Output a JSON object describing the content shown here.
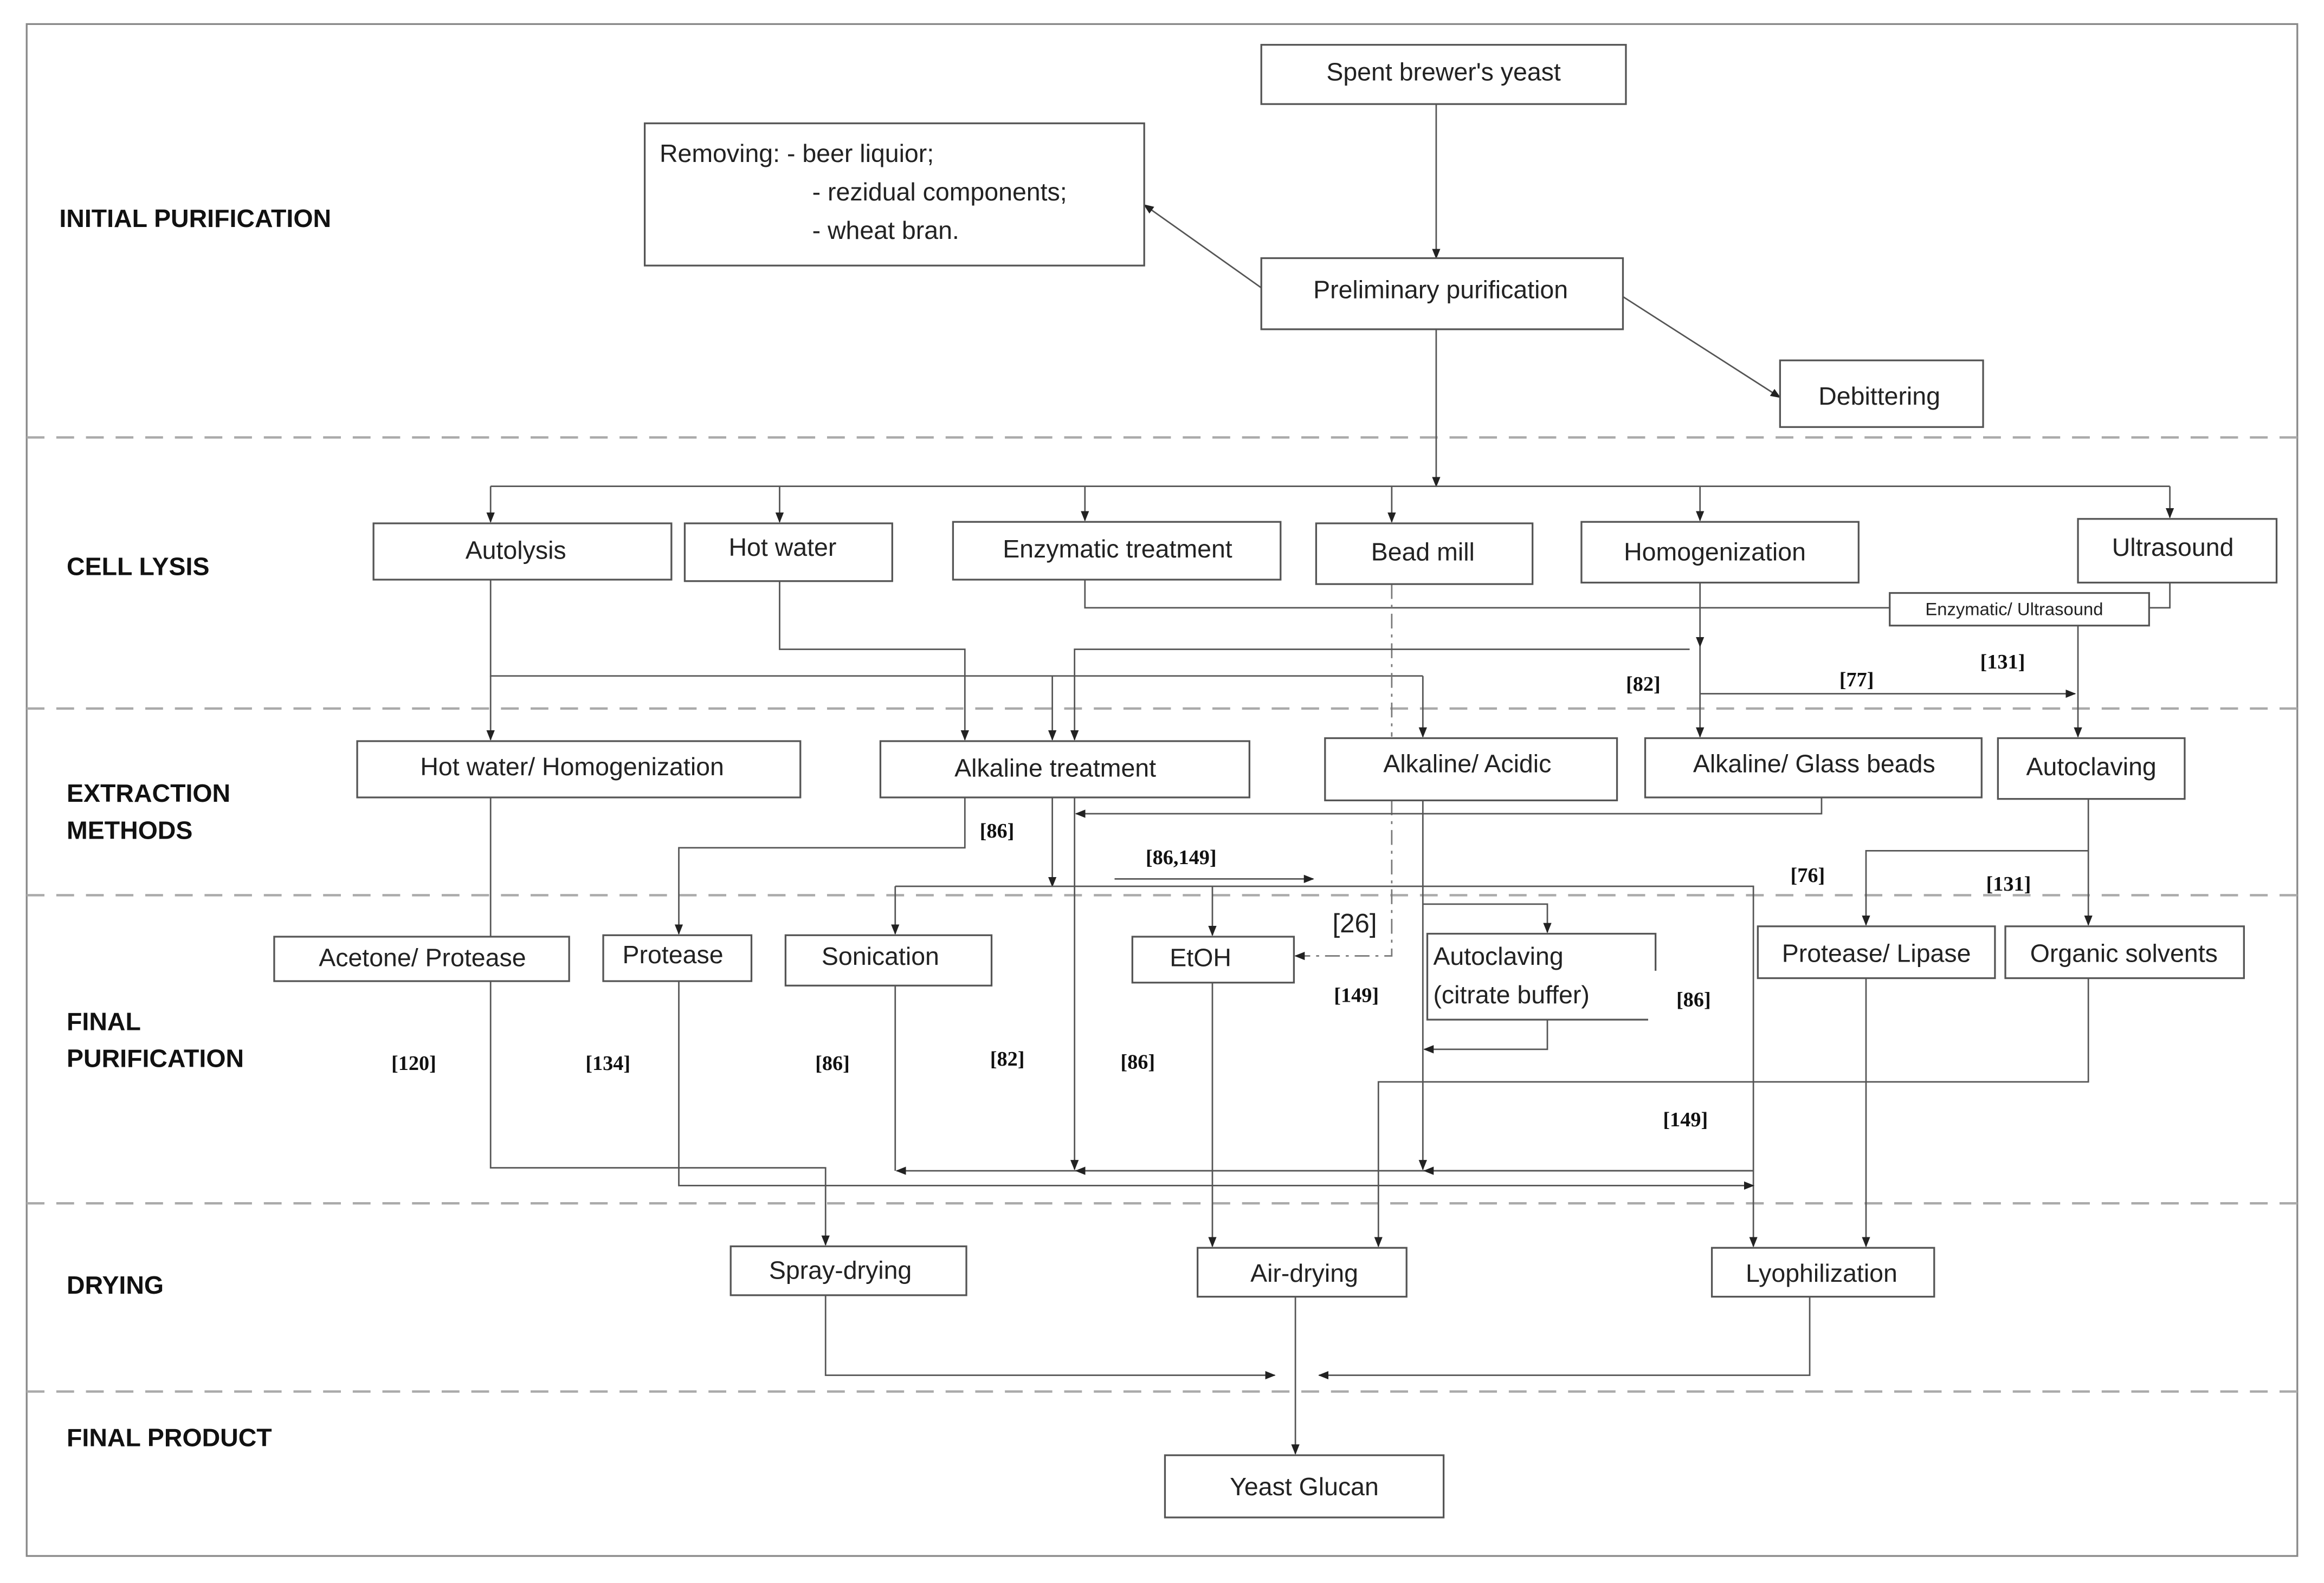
{
  "sections": {
    "initial_purification": "INITIAL PURIFICATION",
    "cell_lysis": "CELL LYSIS",
    "extraction_1": "EXTRACTION",
    "extraction_2": "METHODS",
    "final_purification_1": "FINAL",
    "final_purification_2": "PURIFICATION",
    "drying": "DRYING",
    "final_product": "FINAL PRODUCT"
  },
  "nodes": {
    "spent_yeast": "Spent brewer's yeast",
    "removing_1": "Removing: - beer liquior;",
    "removing_2": "- rezidual components;",
    "removing_3": "- wheat bran.",
    "preliminary": "Preliminary purification",
    "debittering": "Debittering",
    "autolysis": "Autolysis",
    "hot_water": "Hot water",
    "enzymatic": "Enzymatic treatment",
    "bead_mill": "Bead mill",
    "homogenization": "Homogenization",
    "ultrasound": "Ultrasound",
    "enzymatic_ultrasound": "Enzymatic/ Ultrasound",
    "hot_water_homog": "Hot water/ Homogenization",
    "alkaline_treatment": "Alkaline treatment",
    "alkaline_acidic": "Alkaline/ Acidic",
    "alkaline_glass": "Alkaline/ Glass beads",
    "autoclaving": "Autoclaving",
    "acetone_protease": "Acetone/ Protease",
    "protease": "Protease",
    "sonication": "Sonication",
    "etoh": "EtOH",
    "autoclaving_citrate_1": "Autoclaving",
    "autoclaving_citrate_2": "(citrate buffer)",
    "protease_lipase": "Protease/ Lipase",
    "organic_solvents": "Organic solvents",
    "spray_drying": "Spray-drying",
    "air_drying": "Air-drying",
    "lyophilization": "Lyophilization",
    "yeast_glucan": "Yeast Glucan"
  },
  "refs": [
    "[82]",
    "[77]",
    "[131]",
    "[86]",
    "[86,149]",
    "[76]",
    "[131]",
    "[26]",
    "[149]",
    "[86]",
    "[120]",
    "[134]",
    "[86]",
    "[82]",
    "[86]",
    "[149]"
  ]
}
